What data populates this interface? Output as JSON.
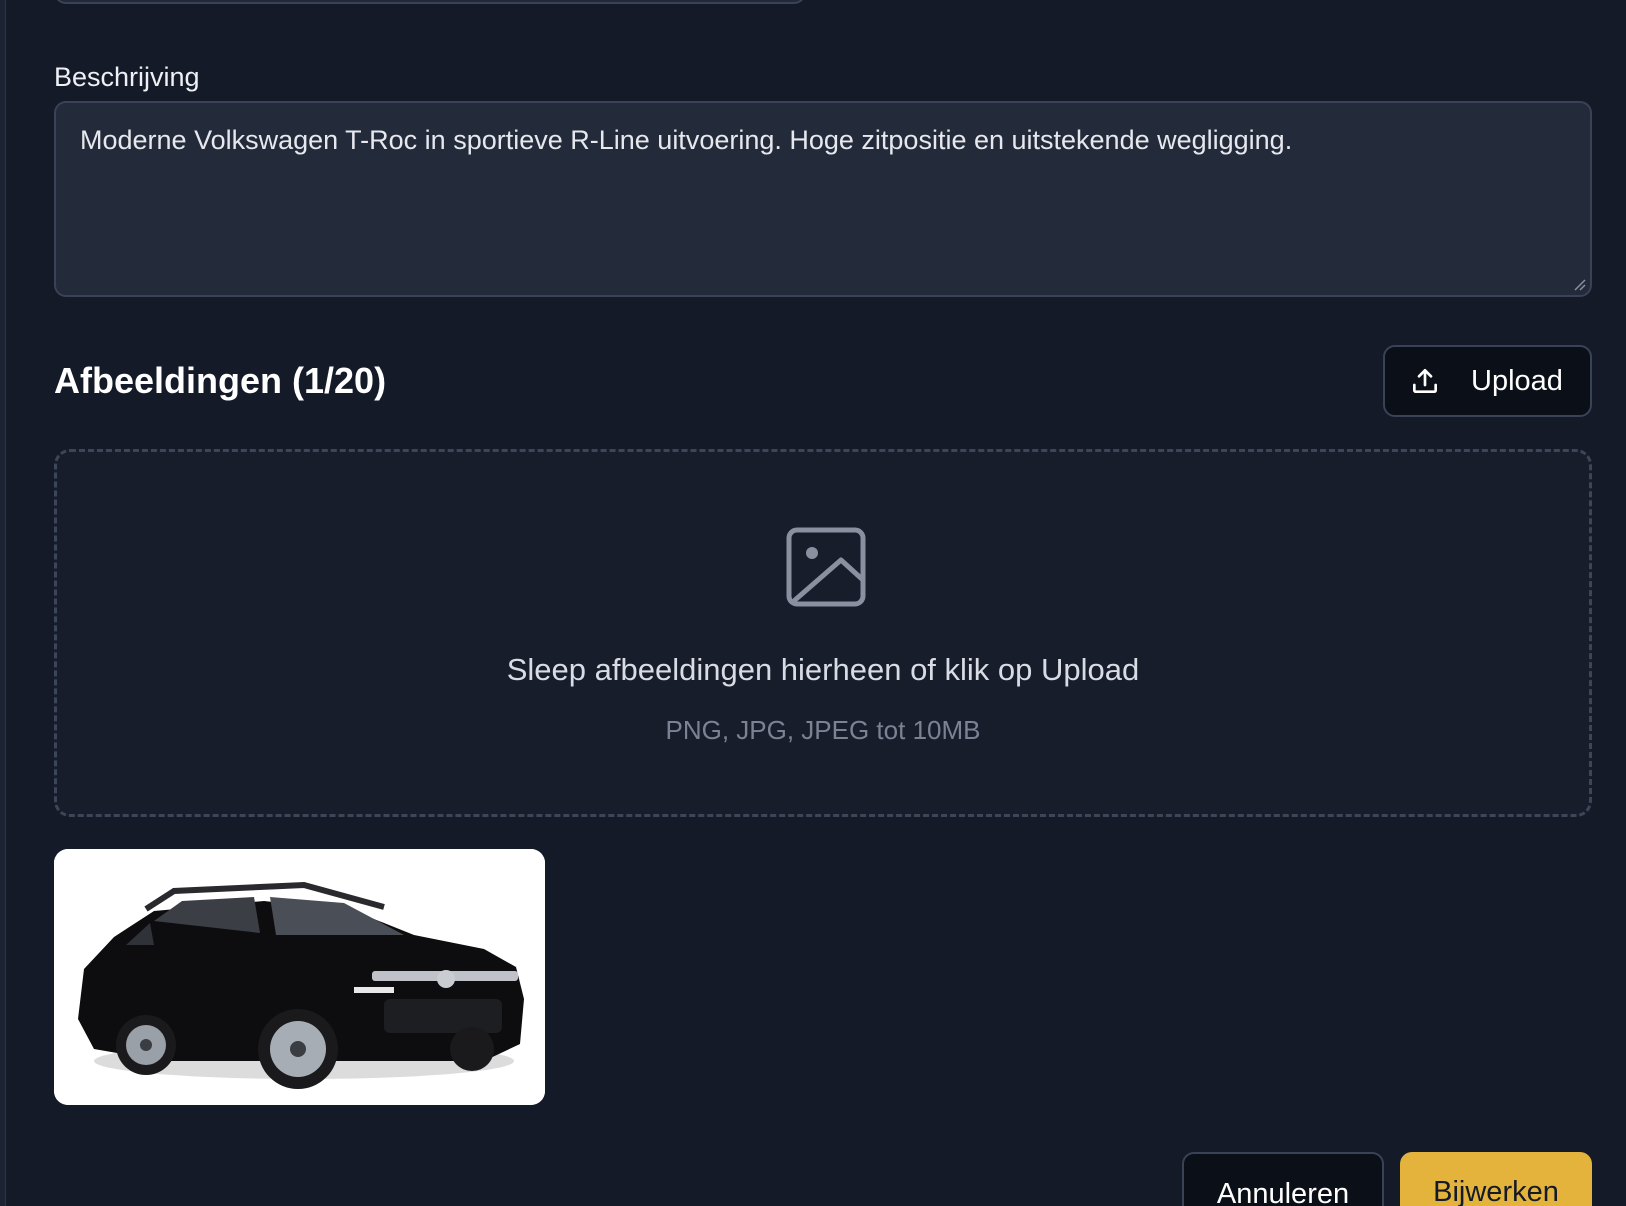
{
  "form": {
    "description_label": "Beschrijving",
    "description_value": "Moderne Volkswagen T-Roc in sportieve R-Line uitvoering. Hoge zitpositie en uitstekende wegligging."
  },
  "images": {
    "title": "Afbeeldingen (1/20)",
    "upload_label": "Upload",
    "dropzone_text": "Sleep afbeeldingen hierheen of klik op Upload",
    "dropzone_hint": "PNG, JPG, JPEG tot 10MB"
  },
  "actions": {
    "cancel_label": "Annuleren",
    "update_label": "Bijwerken"
  },
  "colors": {
    "background": "#141a27",
    "primary_button": "#e3b33c"
  }
}
